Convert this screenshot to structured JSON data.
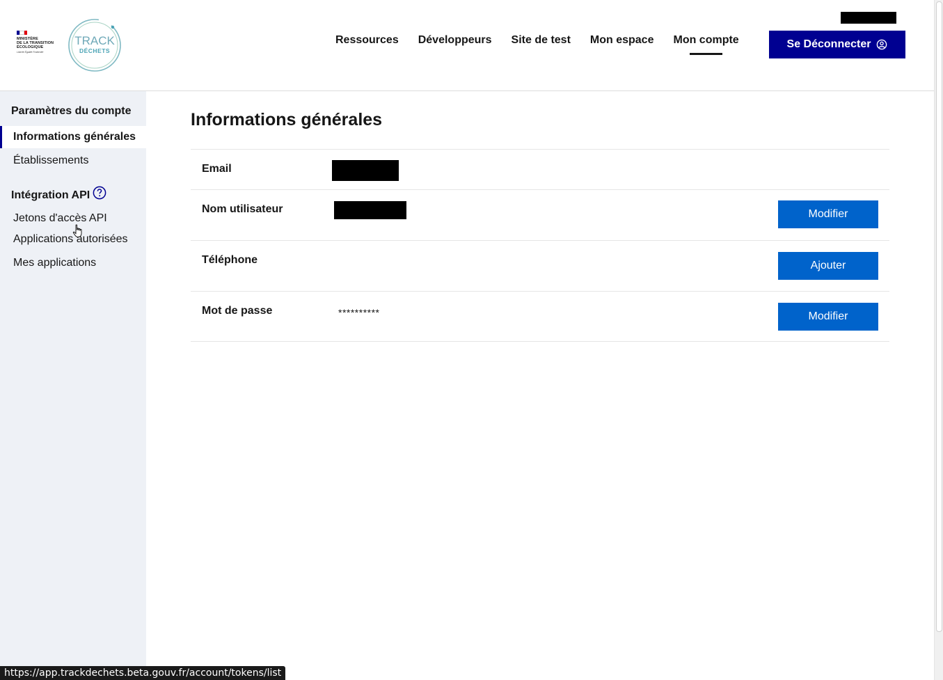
{
  "header": {
    "ministry_text_line1": "MINISTÈRE",
    "ministry_text_line2": "DE LA TRANSITION",
    "ministry_text_line3": "ÉCOLOGIQUE",
    "ministry_motto": "Liberté Égalité Fraternité",
    "logo_line1": "TRACK",
    "logo_line2": "DÉCHETS",
    "nav": [
      "Ressources",
      "Développeurs",
      "Site de test",
      "Mon espace",
      "Mon compte"
    ],
    "active_nav": "Mon compte",
    "logout_label": "Se Déconnecter",
    "logout_icon": "user-circle-icon"
  },
  "sidebar": {
    "section1_title": "Paramètres du compte",
    "section1_items": [
      "Informations générales",
      "Établissements"
    ],
    "section2_title": "Intégration API",
    "section2_icon": "help-circle-icon",
    "section2_items": [
      "Jetons d'accès API",
      "Applications autorisées",
      "Mes applications"
    ]
  },
  "main": {
    "title": "Informations générales",
    "rows": [
      {
        "label": "Email",
        "value": "",
        "button": ""
      },
      {
        "label": "Nom utilisateur",
        "value": "",
        "button": "Modifier"
      },
      {
        "label": "Téléphone",
        "value": "",
        "button": "Ajouter"
      },
      {
        "label": "Mot de passe",
        "value": "**********",
        "button": "Modifier"
      }
    ]
  },
  "status_url": "https://app.trackdechets.beta.gouv.fr/account/tokens/list",
  "colors": {
    "primary_blue": "#000091",
    "button_blue": "#0063cb",
    "sidebar_bg": "#eef1f6"
  }
}
